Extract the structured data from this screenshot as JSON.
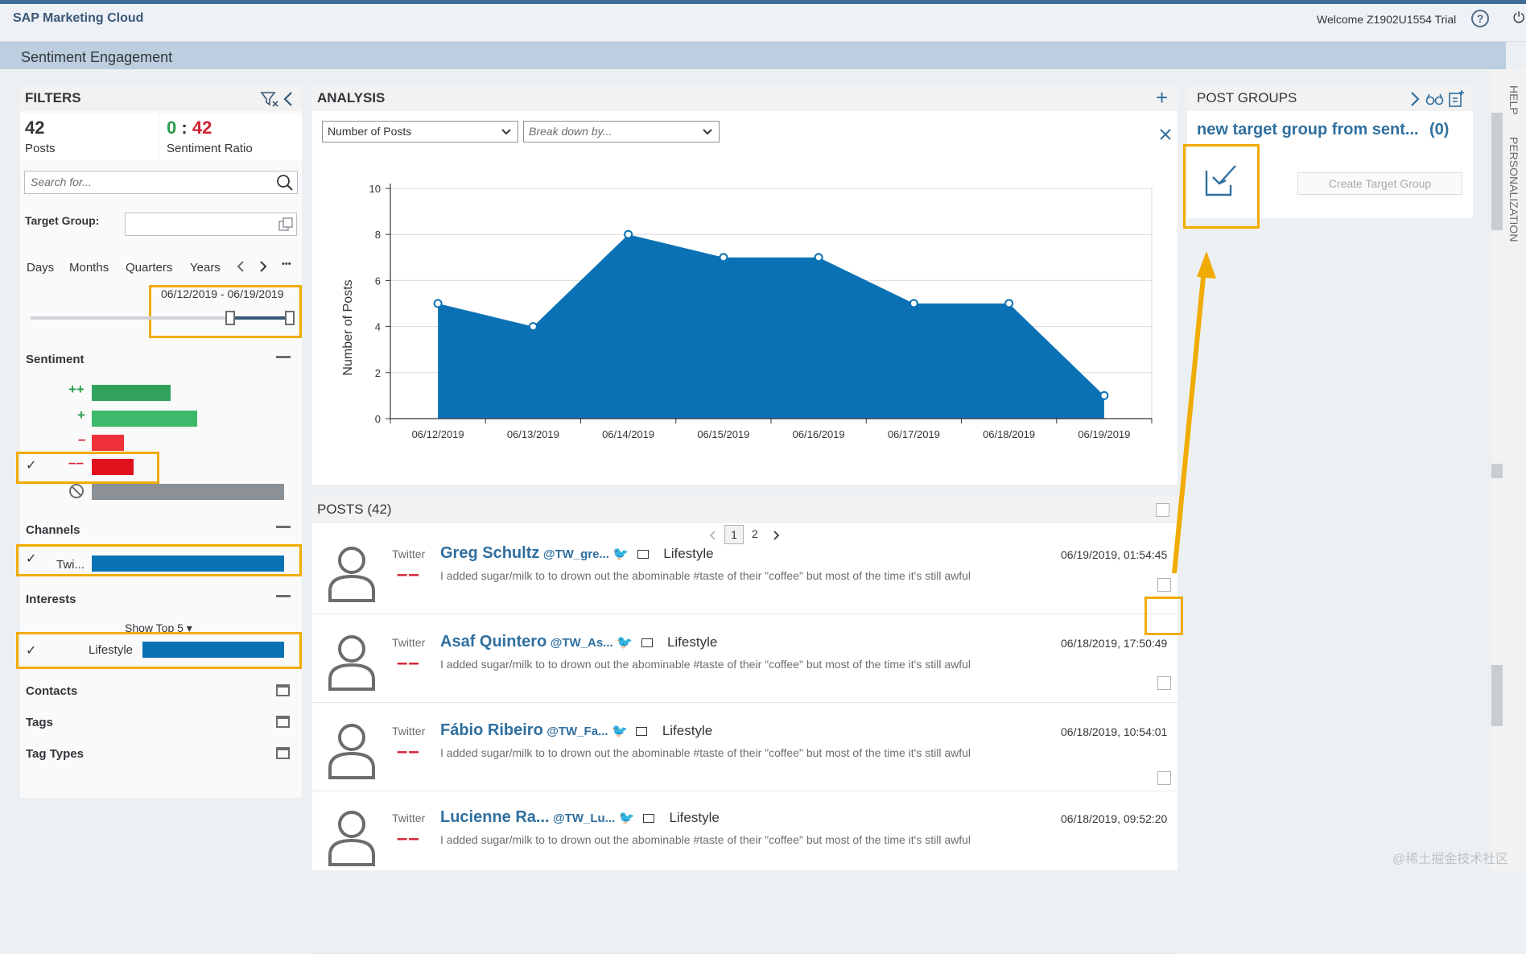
{
  "shell": {
    "app_title": "SAP Marketing Cloud",
    "welcome": "Welcome Z1902U1554 Trial",
    "help_icon": "?",
    "page_title": "Sentiment Engagement"
  },
  "filters": {
    "title": "FILTERS",
    "posts_count": "42",
    "posts_label": "Posts",
    "ratio_positive": "0",
    "ratio_sep": ":",
    "ratio_negative": "42",
    "ratio_label": "Sentiment Ratio",
    "search_placeholder": "Search for...",
    "target_group_label": "Target Group:",
    "time_tabs": [
      "Days",
      "Months",
      "Quarters",
      "Years"
    ],
    "more": "•••",
    "date_range": "06/12/2019 - 06/19/2019",
    "sentiment_label": "Sentiment",
    "sentiment_levels": [
      "++",
      "+",
      "–",
      "––"
    ],
    "sentiment_values": {
      "very_positive": 0.44,
      "positive": 0.59,
      "negative": 0.18,
      "very_negative": 0.23,
      "neutral": 1.0
    },
    "channels_label": "Channels",
    "channel_name": "Twi...",
    "interests_label": "Interests",
    "show_top": "Show Top 5",
    "interest_name": "Lifestyle",
    "contacts_label": "Contacts",
    "tags_label": "Tags",
    "tag_types_label": "Tag Types"
  },
  "analysis": {
    "title": "ANALYSIS",
    "measure_select": "Number of Posts",
    "breakdown_placeholder": "Break down by..."
  },
  "chart_data": {
    "type": "area",
    "title": "",
    "xlabel": "",
    "ylabel": "Number of Posts",
    "categories": [
      "06/12/2019",
      "06/13/2019",
      "06/14/2019",
      "06/15/2019",
      "06/16/2019",
      "06/17/2019",
      "06/18/2019",
      "06/19/2019"
    ],
    "values": [
      5,
      4,
      8,
      7,
      7,
      5,
      5,
      1
    ],
    "ylim": [
      0,
      10
    ],
    "yticks": [
      0,
      2,
      4,
      6,
      8,
      10
    ],
    "grid": true,
    "color": "#0a72b4"
  },
  "posts": {
    "title": "POSTS (42)",
    "pages": [
      "1",
      "2"
    ],
    "items": [
      {
        "channel": "Twitter",
        "user": "Greg Schultz",
        "handle": "@TW_gre...",
        "category": "Lifestyle",
        "date": "06/19/2019, 01:54:45",
        "sentiment": "––",
        "text": "I added sugar/milk to to drown out the abominable #taste of their \"coffee\" but most of the time it's still awful"
      },
      {
        "channel": "Twitter",
        "user": "Asaf Quintero",
        "handle": "@TW_As...",
        "category": "Lifestyle",
        "date": "06/18/2019, 17:50:49",
        "sentiment": "––",
        "text": "I added sugar/milk to to drown out the abominable #taste of their \"coffee\" but most of the time it's still awful"
      },
      {
        "channel": "Twitter",
        "user": "Fábio Ribeiro",
        "handle": "@TW_Fa...",
        "category": "Lifestyle",
        "date": "06/18/2019, 10:54:01",
        "sentiment": "––",
        "text": "I added sugar/milk to to drown out the abominable #taste of their \"coffee\" but most of the time it's still awful"
      },
      {
        "channel": "Twitter",
        "user": "Lucienne Ra...",
        "handle": "@TW_Lu...",
        "category": "Lifestyle",
        "date": "06/18/2019, 09:52:20",
        "sentiment": "––",
        "text": "I added sugar/milk to to drown out the abominable #taste of their \"coffee\" but most of the time it's still awful"
      }
    ]
  },
  "post_groups": {
    "title": "POST GROUPS",
    "group_name": "new target group from sent...",
    "group_count": "(0)",
    "create_button": "Create Target Group"
  },
  "side_tabs": {
    "help": "HELP",
    "personalization": "PERSONALIZATION"
  },
  "watermark": "@稀土掘金技术社区",
  "colors": {
    "accent": "#0a72b4",
    "negative": "#d32030",
    "positive": "#2b9d4b",
    "highlight": "#f0ab00",
    "link": "#2f6f9f"
  }
}
